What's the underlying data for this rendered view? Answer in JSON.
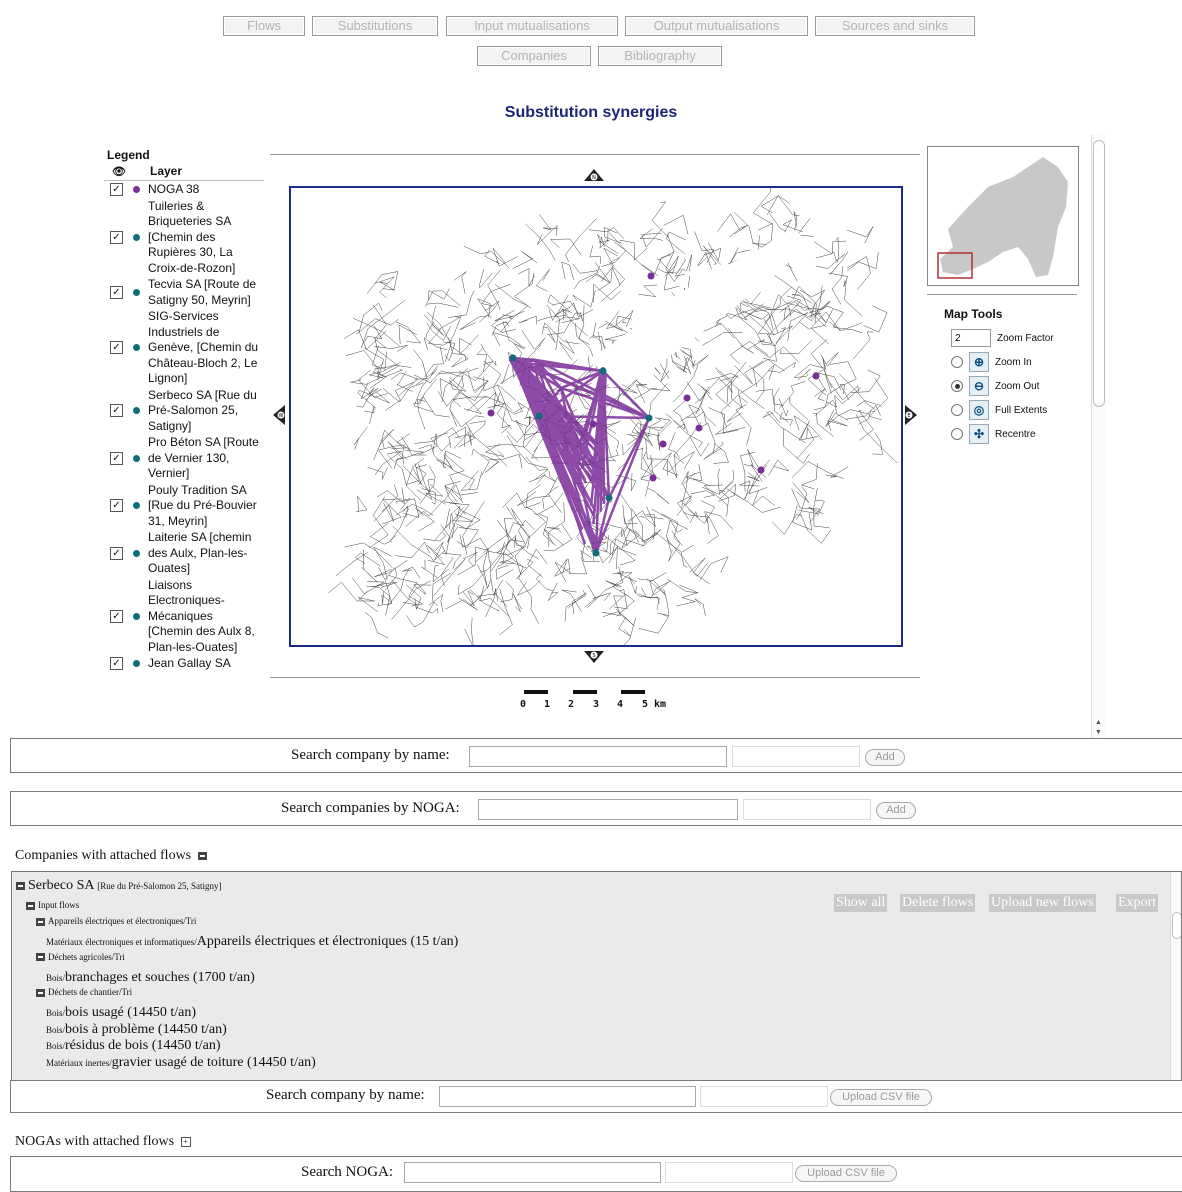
{
  "nav": {
    "row1": [
      "Flows",
      "Substitutions",
      "Input mutualisations",
      "Output mutualisations",
      "Sources and sinks"
    ],
    "row2": [
      "Companies",
      "Bibliography"
    ]
  },
  "page_title": "Substitution synergies",
  "legend": {
    "title": "Legend",
    "layer_header": "Layer",
    "items": [
      {
        "label": "NOGA 38",
        "color": "#7b2d9a"
      },
      {
        "label": "Tuileries & Briqueteries SA [Chemin des Rupières 30, La Croix-de-Rozon]",
        "color": "#106b7a"
      },
      {
        "label": "Tecvia SA [Route de Satigny 50, Meyrin]",
        "color": "#106b7a"
      },
      {
        "label": "SIG-Services Industriels de Genève, [Chemin du Château-Bloch 2, Le Lignon]",
        "color": "#106b7a"
      },
      {
        "label": "Serbeco SA [Rue du Pré-Salomon 25, Satigny]",
        "color": "#106b7a"
      },
      {
        "label": "Pro Béton SA [Route de Vernier 130, Vernier]",
        "color": "#106b7a"
      },
      {
        "label": "Pouly Tradition SA [Rue du Pré-Bouvier 31, Meyrin]",
        "color": "#106b7a"
      },
      {
        "label": "Laiterie SA [chemin des Aulx, Plan-les-Ouates]",
        "color": "#106b7a"
      },
      {
        "label": "Liaisons Electroniques-Mécaniques [Chemin des Aulx 8, Plan-les-Ouates]",
        "color": "#106b7a"
      },
      {
        "label": "Jean Gallay SA",
        "color": "#106b7a"
      }
    ]
  },
  "map": {
    "scale_labels": [
      "0",
      "1",
      "2",
      "3",
      "4",
      "5 km"
    ],
    "compass": {
      "n": "N",
      "s": "S",
      "w": "W",
      "e": "E"
    },
    "flow_color": "#7b2d9a"
  },
  "map_tools": {
    "title": "Map Tools",
    "zoom_factor_value": "2",
    "zoom_factor_label": "Zoom Factor",
    "tools": [
      {
        "label": "Zoom In",
        "icon": "zoom-in-icon",
        "glyph": "⊕",
        "selected": false
      },
      {
        "label": "Zoom Out",
        "icon": "zoom-out-icon",
        "glyph": "⊖",
        "selected": true
      },
      {
        "label": "Full Extents",
        "icon": "full-extents-icon",
        "glyph": "◎",
        "selected": false
      },
      {
        "label": "Recentre",
        "icon": "recentre-icon",
        "glyph": "✣",
        "selected": false
      }
    ]
  },
  "search1": {
    "label": "Search company by name:",
    "button": "Add"
  },
  "search2": {
    "label": "Search companies by NOGA:",
    "button": "Add"
  },
  "companies_section": {
    "title": "Companies with attached flows"
  },
  "company": {
    "name": "Serbeco SA",
    "address": "[Rue du Pré-Salomon 25, Satigny]",
    "input_flows": "Input flows",
    "buttons": [
      "Show all",
      "Delete flows",
      "Upload new flows",
      "Export"
    ],
    "groups": [
      {
        "category": "Appareils électriques et électroniques/Tri",
        "entries": [
          {
            "prefix": "Matériaux électroniques et informatiques/",
            "text": "Appareils électriques et électroniques (15 t/an)"
          }
        ]
      },
      {
        "category": "Déchets agricoles/Tri",
        "entries": [
          {
            "prefix": "Bois/",
            "text": "branchages et souches (1700 t/an)"
          }
        ]
      },
      {
        "category": "Déchets de chantier/Tri",
        "entries": [
          {
            "prefix": "Bois/",
            "text": "bois usagé (14450 t/an)"
          },
          {
            "prefix": "Bois/",
            "text": "bois à problème (14450 t/an)"
          },
          {
            "prefix": "Bois/",
            "text": "résidus de bois (14450 t/an)"
          },
          {
            "prefix": "Matériaux inertes/",
            "text": "gravier usagé de toiture (14450 t/an)"
          }
        ]
      }
    ]
  },
  "search3": {
    "label": "Search company by name:",
    "button": "Upload CSV file"
  },
  "noga_section": {
    "title": "NOGAs with attached flows"
  },
  "search4": {
    "label": "Search NOGA:",
    "button": "Upload CSV file"
  }
}
